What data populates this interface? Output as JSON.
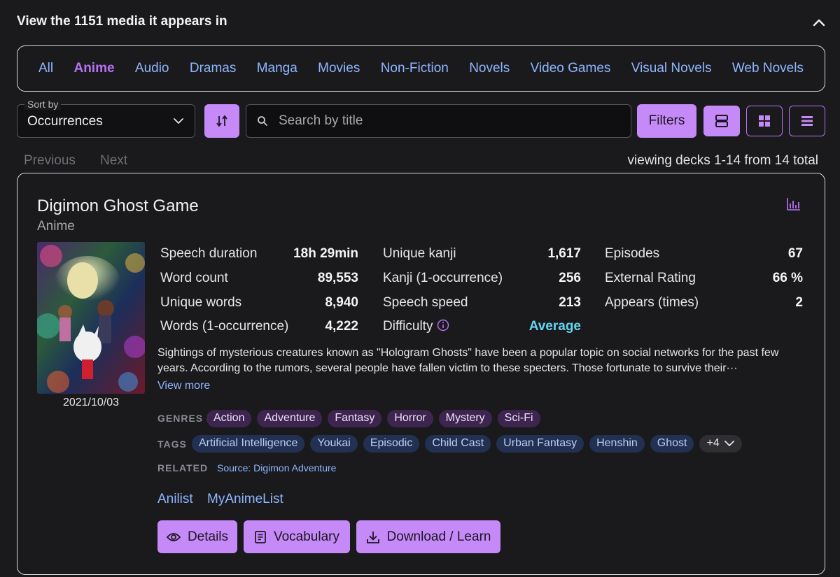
{
  "header": {
    "title": "View the 1151 media it appears in"
  },
  "tabs": [
    {
      "label": "All",
      "active": false
    },
    {
      "label": "Anime",
      "active": true
    },
    {
      "label": "Audio",
      "active": false
    },
    {
      "label": "Dramas",
      "active": false
    },
    {
      "label": "Manga",
      "active": false
    },
    {
      "label": "Movies",
      "active": false
    },
    {
      "label": "Non-Fiction",
      "active": false
    },
    {
      "label": "Novels",
      "active": false
    },
    {
      "label": "Video Games",
      "active": false
    },
    {
      "label": "Visual Novels",
      "active": false
    },
    {
      "label": "Web Novels",
      "active": false
    }
  ],
  "toolbar": {
    "sort_label": "Sort by",
    "sort_value": "Occurrences",
    "search_placeholder": "Search by title",
    "filters_label": "Filters"
  },
  "pagination": {
    "previous": "Previous",
    "next": "Next",
    "summary": "viewing decks 1-14 from 14 total"
  },
  "deck": {
    "title": "Digimon Ghost Game",
    "type": "Anime",
    "date": "2021/10/03",
    "stats_col1": [
      {
        "label": "Speech duration",
        "value": "18h 29min"
      },
      {
        "label": "Word count",
        "value": "89,553"
      },
      {
        "label": "Unique words",
        "value": "8,940"
      },
      {
        "label": "Words (1-occurrence)",
        "value": "4,222"
      }
    ],
    "stats_col2": [
      {
        "label": "Unique kanji",
        "value": "1,617"
      },
      {
        "label": "Kanji (1-occurrence)",
        "value": "256"
      },
      {
        "label": "Speech speed",
        "value": "213"
      },
      {
        "label": "Difficulty",
        "value": "Average"
      }
    ],
    "stats_col3": [
      {
        "label": "Episodes",
        "value": "67"
      },
      {
        "label": "External Rating",
        "value": "66 %"
      },
      {
        "label": "Appears (times)",
        "value": "2"
      }
    ],
    "description": "Sightings of mysterious creatures known as \"Hologram Ghosts\" have been a popular topic on social networks for the past few years. According to the rumors, several people have fallen victim to these specters. Those fortunate to survive their···",
    "view_more": "View more",
    "genres_label": "GENRES",
    "genres": [
      "Action",
      "Adventure",
      "Fantasy",
      "Horror",
      "Mystery",
      "Sci-Fi"
    ],
    "tags_label": "TAGS",
    "tags": [
      "Artificial Intelligence",
      "Youkai",
      "Episodic",
      "Child Cast",
      "Urban Fantasy",
      "Henshin",
      "Ghost"
    ],
    "tags_more": "+4",
    "related_label": "RELATED",
    "related": "Source:  Digimon Adventure",
    "links": [
      "Anilist",
      "MyAnimeList"
    ],
    "actions": {
      "details": "Details",
      "vocabulary": "Vocabulary",
      "download": "Download / Learn"
    }
  },
  "colors": {
    "accent": "#c58af8",
    "active_tab": "#b772f5",
    "link": "#8fb6ff",
    "difficulty_average": "#66d4f0",
    "genre_chip": "#3e2550",
    "tag_chip": "#223152",
    "background": "#1a1a1d"
  }
}
